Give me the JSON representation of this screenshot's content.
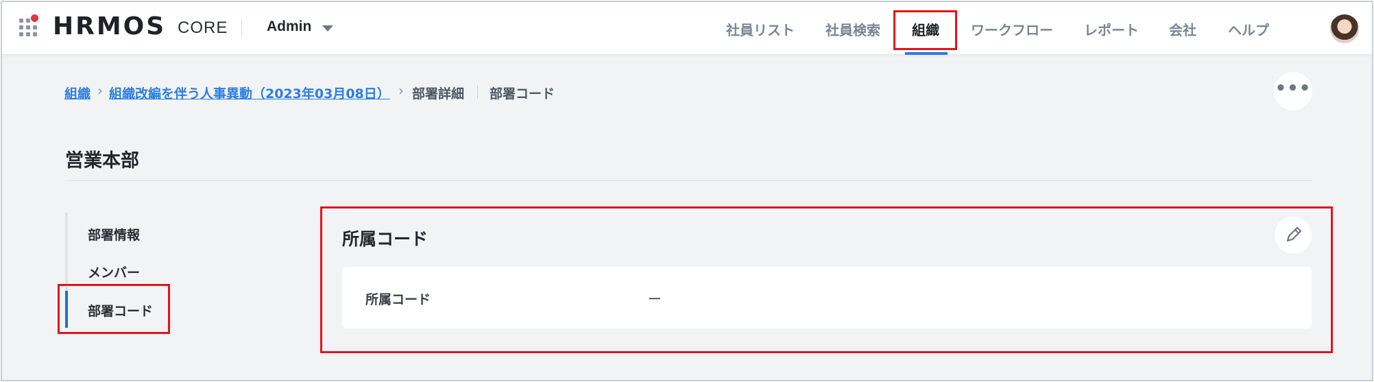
{
  "header": {
    "logo": "HRMOS",
    "product": "CORE",
    "role": "Admin",
    "nav": [
      {
        "label": "社員リスト"
      },
      {
        "label": "社員検索"
      },
      {
        "label": "組織"
      },
      {
        "label": "ワークフロー"
      },
      {
        "label": "レポート"
      },
      {
        "label": "会社"
      },
      {
        "label": "ヘルプ"
      }
    ],
    "active_nav": "組織",
    "icons": {
      "apps": "apps-grid-icon",
      "role_caret": "caret-down-icon",
      "avatar": "user-avatar"
    }
  },
  "breadcrumb": {
    "items": [
      {
        "label": "組織"
      },
      {
        "label": "組織改編を伴う人事異動（2023年03月08日）"
      },
      {
        "label": "部署詳細"
      },
      {
        "label": "部署コード"
      }
    ],
    "separator": "›"
  },
  "more_button": {
    "label": "•••"
  },
  "page": {
    "title": "営業本部"
  },
  "side_menu": {
    "items": [
      {
        "label": "部署情報"
      },
      {
        "label": "メンバー"
      },
      {
        "label": "部署コード"
      }
    ],
    "active": "部署コード"
  },
  "panel": {
    "title": "所属コード",
    "row": {
      "label": "所属コード",
      "value": "ー"
    },
    "edit_icon": "pencil-icon"
  },
  "colors": {
    "accent": "#2b7de0",
    "highlight_box": "#e0151b",
    "background": "#f2f3f5",
    "active_indicator": "#1e6fd0"
  }
}
